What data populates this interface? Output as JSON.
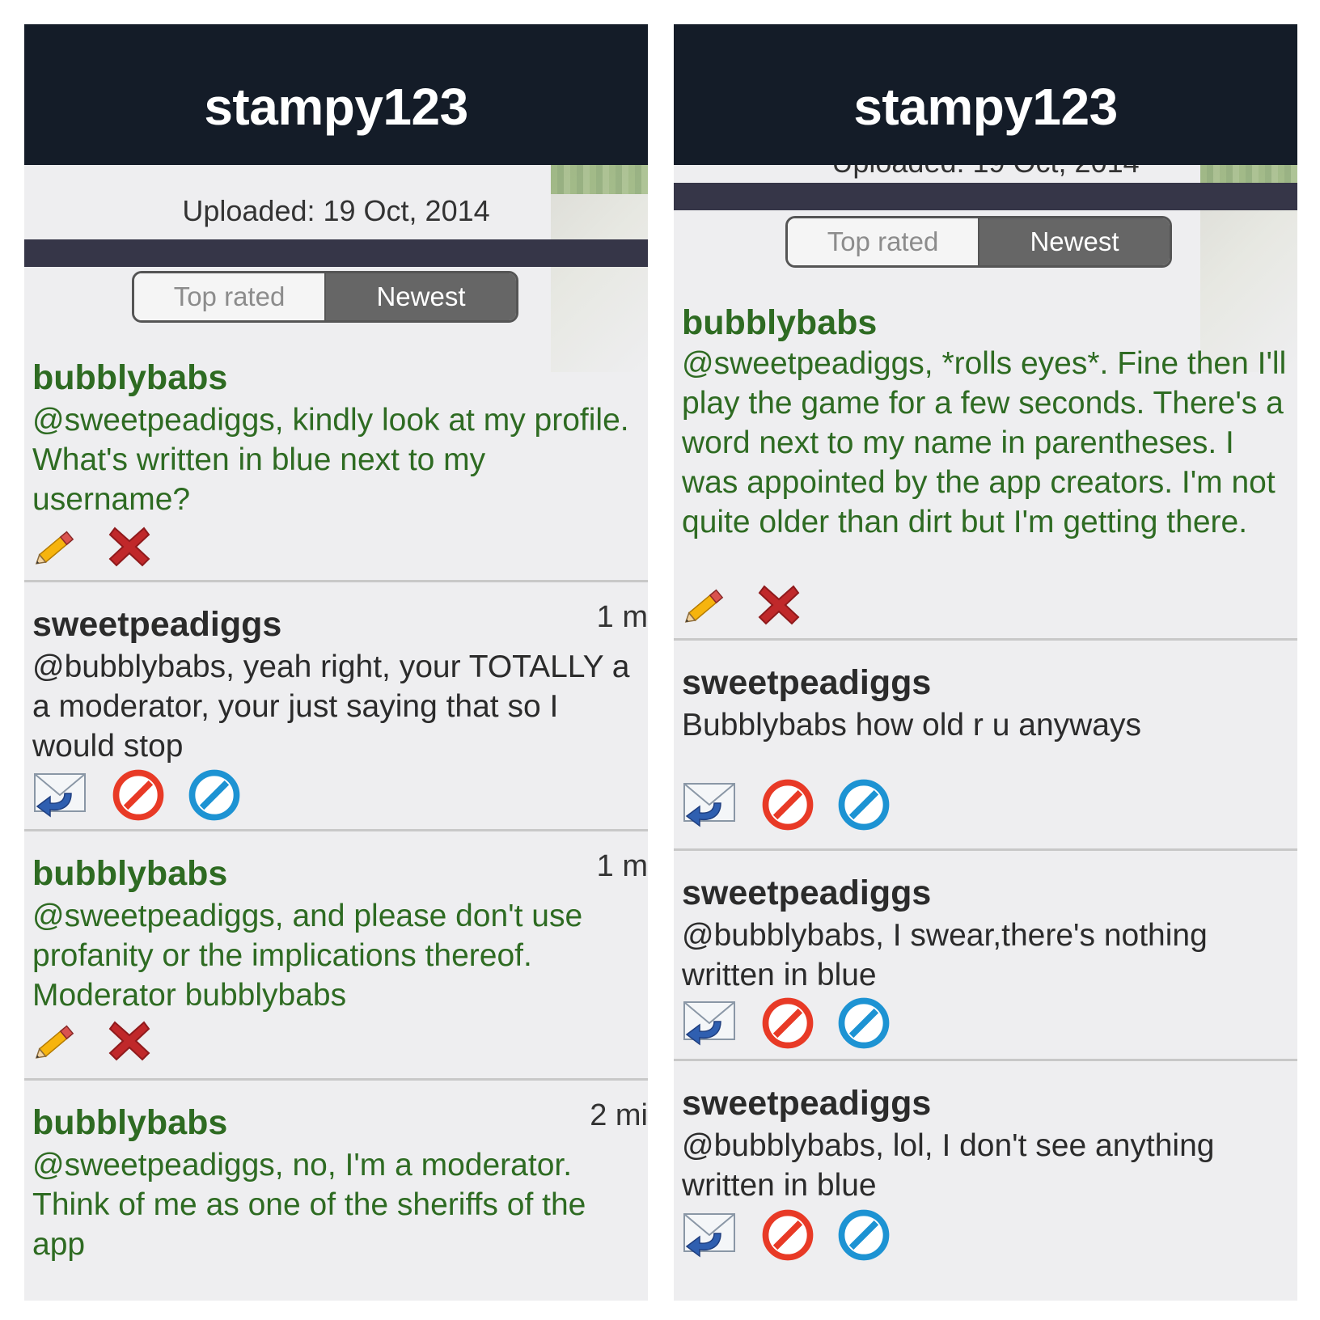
{
  "left": {
    "title": "stampy123",
    "uploaded": "Uploaded: 19 Oct, 2014",
    "tabs": {
      "top_rated": "Top rated",
      "newest": "Newest"
    },
    "comments": [
      {
        "author": "bubblybabs",
        "time": "",
        "text": "@sweetpeadiggs, kindly look at my profile. What's written in blue next to my username?"
      },
      {
        "author": "sweetpeadiggs",
        "time": "1 m",
        "text": "@bubblybabs, yeah right, your TOTALLY a a moderator, your just saying that so I would stop"
      },
      {
        "author": "bubblybabs",
        "time": "1 m",
        "text": "@sweetpeadiggs, and please don't use profanity or the implications thereof. Moderator bubblybabs"
      },
      {
        "author": "bubblybabs",
        "time": "2 mi",
        "text": "@sweetpeadiggs, no, I'm a moderator. Think of me as one of the sheriffs of the app"
      }
    ]
  },
  "right": {
    "title": "stampy123",
    "uploaded": "Uploaded: 19 Oct, 2014",
    "tabs": {
      "top_rated": "Top rated",
      "newest": "Newest"
    },
    "comments": [
      {
        "author": "bubblybabs",
        "text": "@sweetpeadiggs, *rolls eyes*. Fine then I'll play the game for a few seconds. There's a word next to my name in parentheses.  I was appointed by the app creators.  I'm not quite older than dirt but I'm getting there."
      },
      {
        "author": "sweetpeadiggs",
        "text": "Bubblybabs how old r u anyways"
      },
      {
        "author": "sweetpeadiggs",
        "text": "@bubblybabs, I swear,there's nothing written in blue"
      },
      {
        "author": "sweetpeadiggs",
        "text": "@bubblybabs, lol, I don't see anything written in blue"
      }
    ]
  },
  "icons": {
    "edit": "pencil-icon",
    "delete": "red-x-icon",
    "reply": "reply-mail-icon",
    "block": "red-block-icon",
    "moderate": "blue-block-icon"
  },
  "colors": {
    "header_bg": "#141c28",
    "moderator_text": "#2e6b22",
    "user_text": "#2b2b2b",
    "segment_active": "#666666",
    "divider_bar": "#363648"
  }
}
